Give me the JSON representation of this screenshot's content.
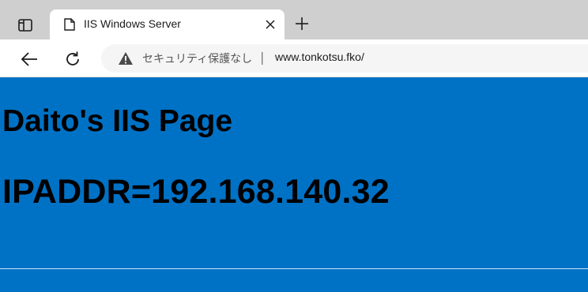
{
  "browser": {
    "tab": {
      "title": "IIS Windows Server"
    },
    "address_bar": {
      "security_label": "セキュリティ保護なし",
      "separator": "|",
      "url": "www.tonkotsu.fko/"
    },
    "icons": {
      "tab_actions": "tab-actions-icon",
      "page": "page-icon",
      "close": "close-icon",
      "new_tab": "plus-icon",
      "back": "back-arrow-icon",
      "reload": "reload-icon",
      "warning": "warning-triangle-icon"
    }
  },
  "page": {
    "heading": "Daito's IIS Page",
    "ip_line": "IPADDR=192.168.140.32",
    "background_color": "#0072c6"
  }
}
